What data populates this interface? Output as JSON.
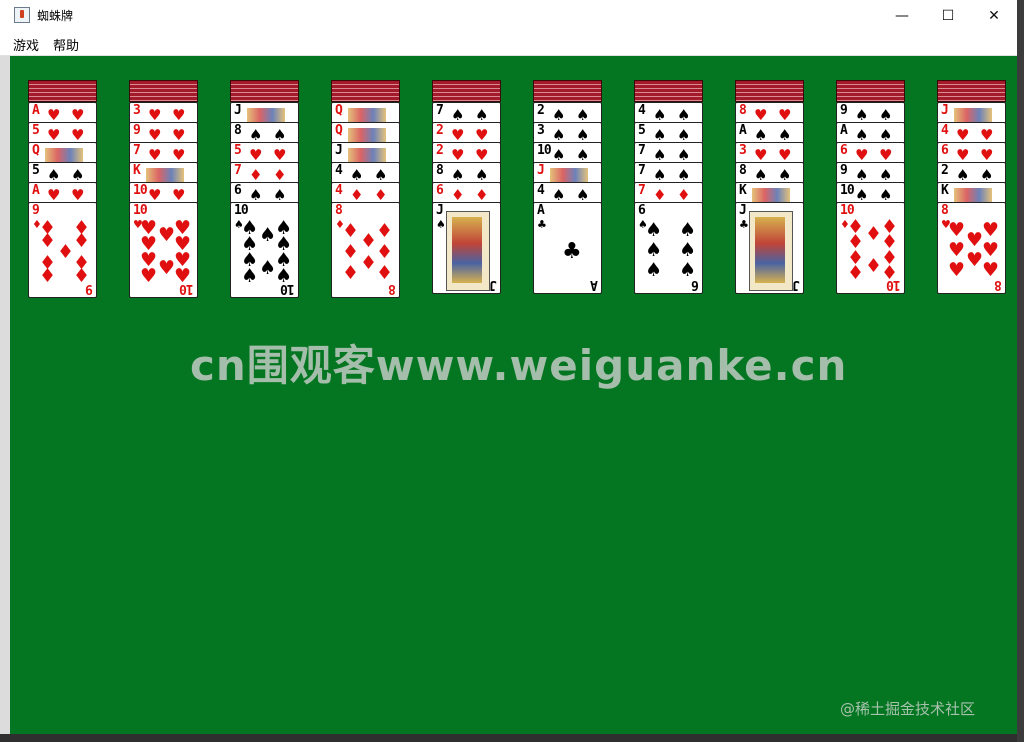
{
  "window": {
    "title": "蜘蛛牌",
    "minimize": "—",
    "maximize": "☐",
    "close": "✕"
  },
  "menu": {
    "game": "游戏",
    "help": "帮助"
  },
  "watermark": "cn围观客www.weiguanke.cn",
  "credit": "@稀土掘金技术社区",
  "colors": {
    "felt": "#047520",
    "card_back": "#a31b2a",
    "red_suit": "#e01010"
  },
  "suits": {
    "S": "♠",
    "H": "♥",
    "D": "♦",
    "C": "♣"
  },
  "columns": [
    {
      "backs": 4,
      "cards": [
        {
          "r": "A",
          "s": "H"
        },
        {
          "r": "5",
          "s": "H"
        },
        {
          "r": "Q",
          "s": "H"
        },
        {
          "r": "5",
          "s": "S"
        },
        {
          "r": "A",
          "s": "H"
        },
        {
          "r": "9",
          "s": "D"
        }
      ]
    },
    {
      "backs": 4,
      "cards": [
        {
          "r": "3",
          "s": "H"
        },
        {
          "r": "9",
          "s": "H"
        },
        {
          "r": "7",
          "s": "H"
        },
        {
          "r": "K",
          "s": "H"
        },
        {
          "r": "10",
          "s": "H"
        },
        {
          "r": "10",
          "s": "H"
        }
      ]
    },
    {
      "backs": 4,
      "cards": [
        {
          "r": "J",
          "s": "S"
        },
        {
          "r": "8",
          "s": "S"
        },
        {
          "r": "5",
          "s": "H"
        },
        {
          "r": "7",
          "s": "D"
        },
        {
          "r": "6",
          "s": "S"
        },
        {
          "r": "10",
          "s": "S"
        }
      ]
    },
    {
      "backs": 4,
      "cards": [
        {
          "r": "Q",
          "s": "H"
        },
        {
          "r": "Q",
          "s": "H"
        },
        {
          "r": "J",
          "s": "S"
        },
        {
          "r": "4",
          "s": "S"
        },
        {
          "r": "4",
          "s": "D"
        },
        {
          "r": "8",
          "s": "D"
        }
      ]
    },
    {
      "backs": 3,
      "cards": [
        {
          "r": "7",
          "s": "S"
        },
        {
          "r": "2",
          "s": "H"
        },
        {
          "r": "2",
          "s": "H"
        },
        {
          "r": "8",
          "s": "S"
        },
        {
          "r": "6",
          "s": "D"
        },
        {
          "r": "J",
          "s": "S"
        }
      ]
    },
    {
      "backs": 3,
      "cards": [
        {
          "r": "2",
          "s": "S"
        },
        {
          "r": "3",
          "s": "S"
        },
        {
          "r": "10",
          "s": "S"
        },
        {
          "r": "J",
          "s": "H"
        },
        {
          "r": "4",
          "s": "S"
        },
        {
          "r": "A",
          "s": "C"
        }
      ]
    },
    {
      "backs": 3,
      "cards": [
        {
          "r": "4",
          "s": "S"
        },
        {
          "r": "5",
          "s": "S"
        },
        {
          "r": "7",
          "s": "S"
        },
        {
          "r": "7",
          "s": "S"
        },
        {
          "r": "7",
          "s": "D"
        },
        {
          "r": "6",
          "s": "S"
        }
      ]
    },
    {
      "backs": 3,
      "cards": [
        {
          "r": "8",
          "s": "H"
        },
        {
          "r": "A",
          "s": "S"
        },
        {
          "r": "3",
          "s": "H"
        },
        {
          "r": "8",
          "s": "S"
        },
        {
          "r": "K",
          "s": "S"
        },
        {
          "r": "J",
          "s": "C"
        }
      ]
    },
    {
      "backs": 3,
      "cards": [
        {
          "r": "9",
          "s": "S"
        },
        {
          "r": "A",
          "s": "S"
        },
        {
          "r": "6",
          "s": "H"
        },
        {
          "r": "9",
          "s": "S"
        },
        {
          "r": "10",
          "s": "S"
        },
        {
          "r": "10",
          "s": "D"
        }
      ]
    },
    {
      "backs": 3,
      "cards": [
        {
          "r": "J",
          "s": "H"
        },
        {
          "r": "4",
          "s": "H"
        },
        {
          "r": "6",
          "s": "H"
        },
        {
          "r": "2",
          "s": "S"
        },
        {
          "r": "K",
          "s": "S"
        },
        {
          "r": "8",
          "s": "H"
        }
      ]
    }
  ]
}
